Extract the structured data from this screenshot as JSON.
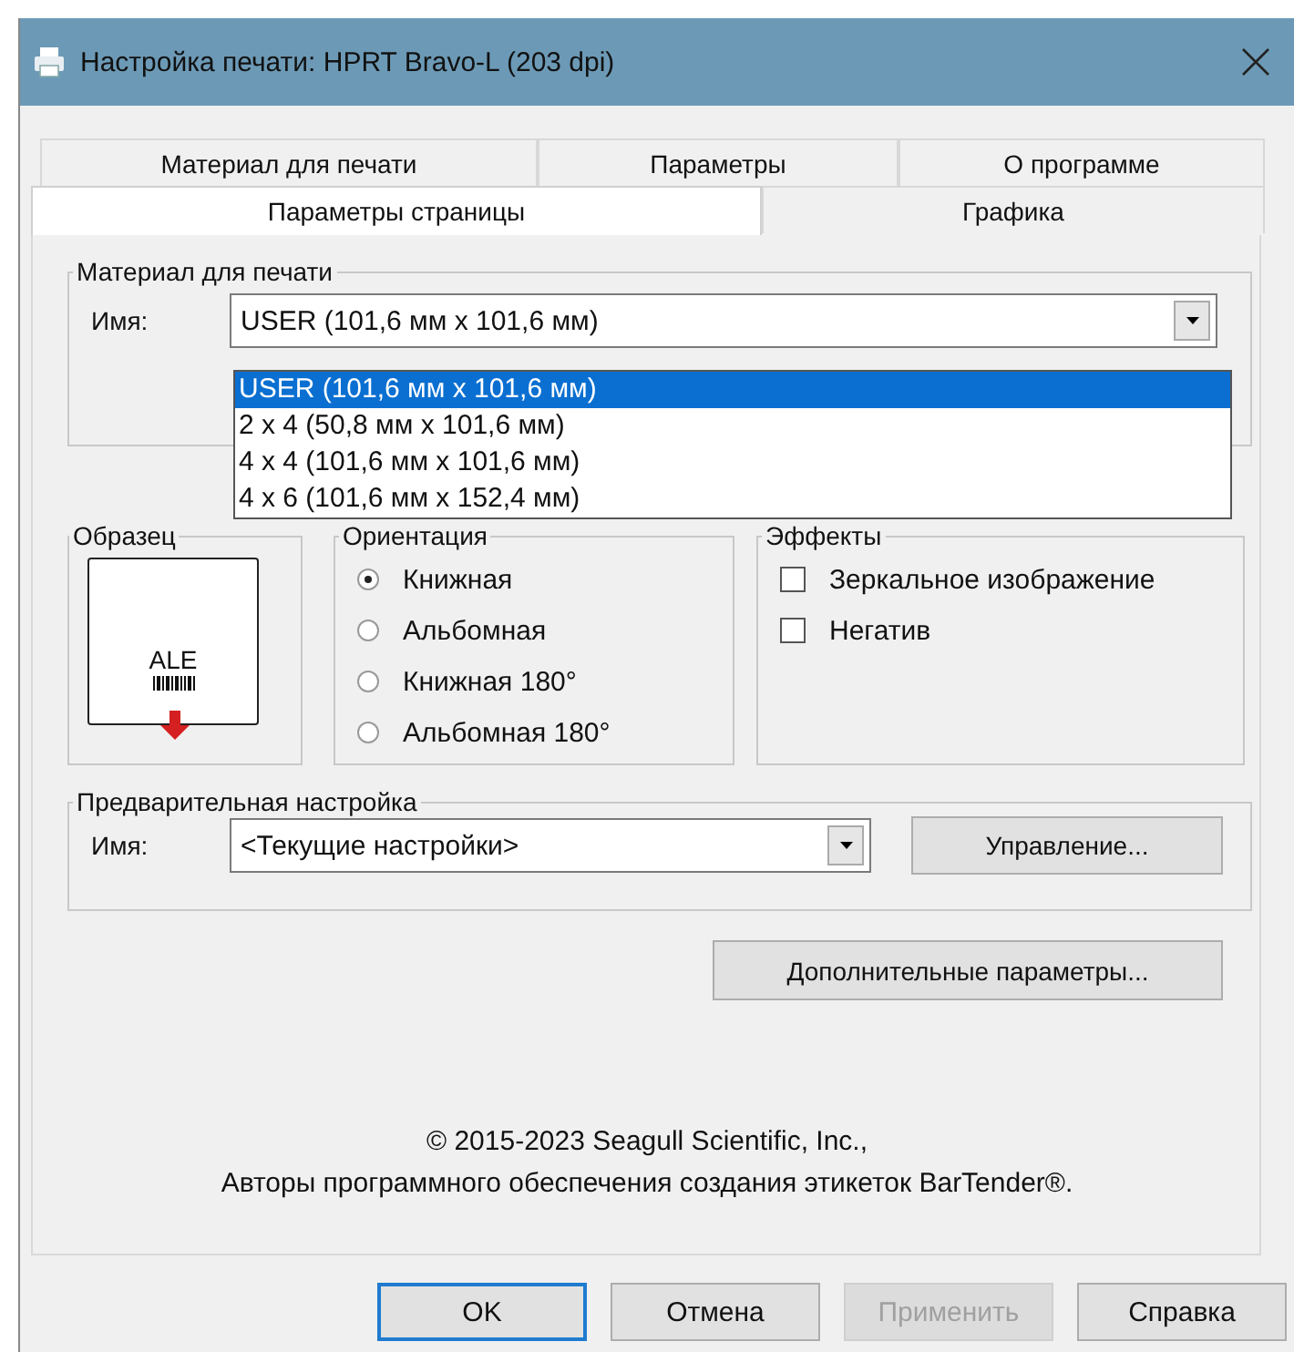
{
  "window": {
    "title": "Настройка печати: HPRT Bravo-L (203 dpi)"
  },
  "tab_rows": [
    [
      {
        "label": "Материал для печати",
        "selected": false
      },
      {
        "label": "Параметры",
        "selected": false
      },
      {
        "label": "О программе",
        "selected": false
      }
    ],
    [
      {
        "label": "Параметры страницы",
        "selected": true
      },
      {
        "label": "Графика",
        "selected": false
      }
    ]
  ],
  "media": {
    "legend": "Материал для печати",
    "name_label": "Имя:",
    "value": "USER (101,6 мм x 101,6 мм)",
    "dropdown_open": true,
    "items": [
      {
        "label": "USER (101,6 мм x 101,6 мм)",
        "selected": true
      },
      {
        "label": "2 x 4 (50,8 мм x 101,6 мм)",
        "selected": false
      },
      {
        "label": "4 x 4 (101,6 мм x 101,6 мм)",
        "selected": false
      },
      {
        "label": "4 x 6 (101,6 мм x 152,4 мм)",
        "selected": false
      }
    ]
  },
  "sample": {
    "legend": "Образец",
    "text": "ALE"
  },
  "orientation": {
    "legend": "Ориентация",
    "options": [
      {
        "label": "Книжная",
        "selected": true
      },
      {
        "label": "Альбомная",
        "selected": false
      },
      {
        "label": "Книжная 180°",
        "selected": false
      },
      {
        "label": "Альбомная 180°",
        "selected": false
      }
    ]
  },
  "effects": {
    "legend": "Эффекты",
    "options": [
      {
        "label": "Зеркальное изображение",
        "checked": false
      },
      {
        "label": "Негатив",
        "checked": false
      }
    ]
  },
  "preset": {
    "legend": "Предварительная настройка",
    "name_label": "Имя:",
    "value": "<Текущие настройки>",
    "button": "Управление..."
  },
  "advanced_button": "Дополнительные параметры...",
  "copyright": [
    "© 2015-2023 Seagull Scientific, Inc.,",
    "Авторы программного обеспечения создания этикеток BarTender®."
  ],
  "buttons": [
    {
      "label": "OK",
      "default": true,
      "disabled": false
    },
    {
      "label": "Отмена",
      "default": false,
      "disabled": false
    },
    {
      "label": "Применить",
      "default": false,
      "disabled": true
    },
    {
      "label": "Справка",
      "default": false,
      "disabled": false
    }
  ]
}
